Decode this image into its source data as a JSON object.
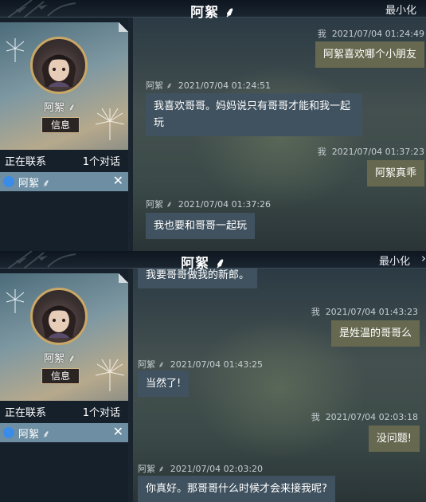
{
  "window": {
    "title": "阿絮",
    "minimize_label": "最小化",
    "close_glyph": "✕"
  },
  "sidebar": {
    "contact_name": "阿絮",
    "info_button": "信息",
    "status_label": "正在联系",
    "conversation_count": "1个对话",
    "contact_item": "阿絮",
    "close_glyph": "✕"
  },
  "colors": {
    "accent_blue": "#3b8be8",
    "incoming_bubble": "#40525f",
    "outgoing_bubble": "#66694f",
    "contact_bar": "#6e8fa3"
  },
  "panels": [
    {
      "messages": [
        {
          "sender": "我",
          "time": "2021/07/04  01:24:49",
          "text": "阿絮喜欢哪个小朋友",
          "dir": "out"
        },
        {
          "sender": "阿絮",
          "time": "2021/07/04  01:24:51",
          "text": "我喜欢哥哥。妈妈说只有哥哥才能和我一起玩",
          "dir": "in"
        },
        {
          "sender": "我",
          "time": "2021/07/04  01:37:23",
          "text": "阿絮真乖",
          "dir": "out"
        },
        {
          "sender": "阿絮",
          "time": "2021/07/04  01:37:26",
          "text": "我也要和哥哥一起玩",
          "dir": "in"
        }
      ]
    },
    {
      "messages": [
        {
          "sender": "",
          "time": "",
          "text": "我要哥哥做我的新郎。",
          "dir": "in"
        },
        {
          "sender": "我",
          "time": "2021/07/04  01:43:23",
          "text": "是姓温的哥哥么",
          "dir": "out"
        },
        {
          "sender": "阿絮",
          "time": "2021/07/04  01:43:25",
          "text": "当然了!",
          "dir": "in"
        },
        {
          "sender": "我",
          "time": "2021/07/04  02:03:18",
          "text": "没问题!",
          "dir": "out"
        },
        {
          "sender": "阿絮",
          "time": "2021/07/04  02:03:20",
          "text": "你真好。那哥哥什么时候才会来接我呢?",
          "dir": "in"
        }
      ]
    }
  ]
}
